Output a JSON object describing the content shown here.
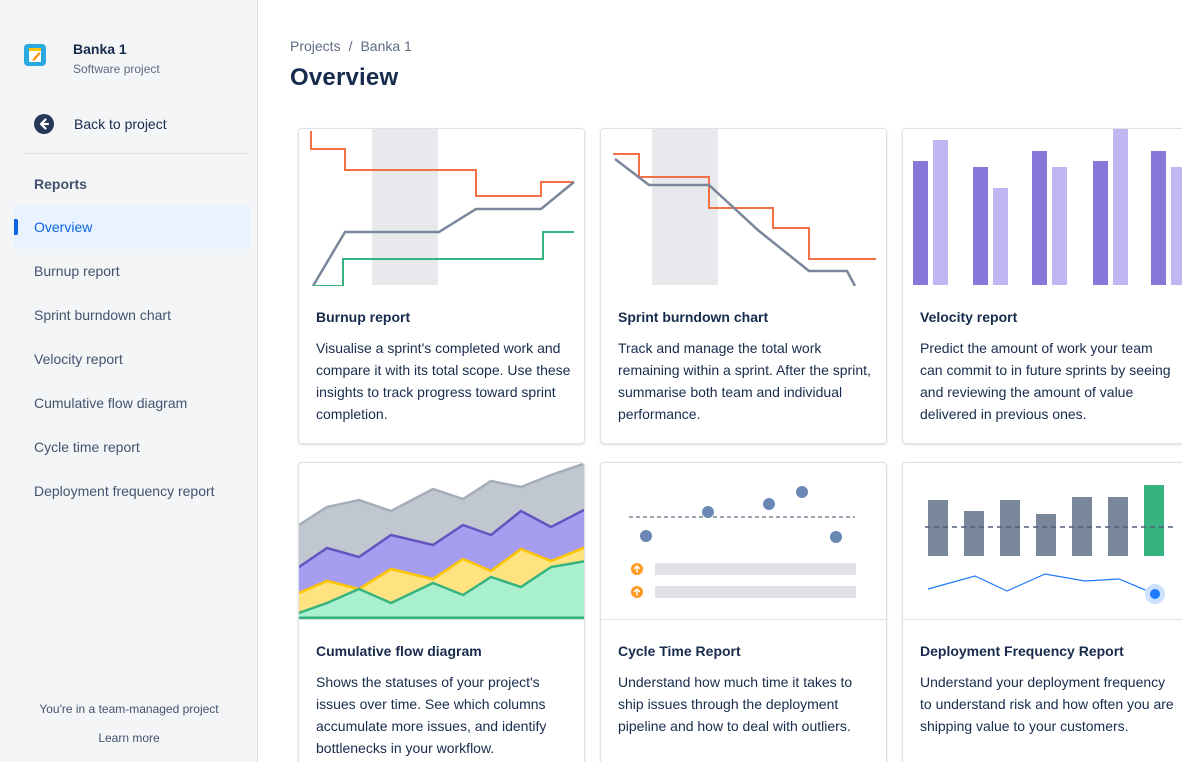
{
  "sidebar": {
    "project_name": "Banka 1",
    "project_type": "Software project",
    "back_label": "Back to project",
    "section_title": "Reports",
    "items": [
      {
        "label": "Overview",
        "active": true
      },
      {
        "label": "Burnup report",
        "active": false
      },
      {
        "label": "Sprint burndown chart",
        "active": false
      },
      {
        "label": "Velocity report",
        "active": false
      },
      {
        "label": "Cumulative flow diagram",
        "active": false
      },
      {
        "label": "Cycle time report",
        "active": false
      },
      {
        "label": "Deployment frequency report",
        "active": false
      }
    ],
    "team_note": "You're in a team-managed project",
    "learn_more": "Learn more"
  },
  "header": {
    "breadcrumb": [
      "Projects",
      "Banka 1"
    ],
    "title": "Overview"
  },
  "cards": [
    {
      "id": "burnup",
      "title": "Burnup report",
      "description": "Visualise a sprint's completed work and compare it with its total scope. Use these insights to track progress toward sprint completion."
    },
    {
      "id": "burndown",
      "title": "Sprint burndown chart",
      "description": "Track and manage the total work remaining within a sprint. After the sprint, summarise both team and individual performance."
    },
    {
      "id": "velocity",
      "title": "Velocity report",
      "description": "Predict the amount of work your team can commit to in future sprints by seeing and reviewing the amount of value delivered in previous ones."
    },
    {
      "id": "cfd",
      "title": "Cumulative flow diagram",
      "description": "Shows the statuses of your project's issues over time. See which columns accumulate more issues, and identify bottlenecks in your workflow."
    },
    {
      "id": "cycle",
      "title": "Cycle Time Report",
      "description": "Understand how much time it takes to ship issues through the deployment pipeline and how to deal with outliers."
    },
    {
      "id": "deploy",
      "title": "Deployment Frequency Report",
      "description": "Understand your deployment frequency to understand risk and how often you are shipping value to your customers."
    }
  ],
  "colors": {
    "active_blue": "#0c66e4",
    "scope_orange": "#f46f45",
    "progress_gray": "#7a869a",
    "done_green": "#36b37e",
    "velocity_dark": "#8777d9",
    "velocity_light": "#c0b6f2",
    "cfd_gray": "#c1c7d0",
    "cfd_purple": "#a79df0",
    "cfd_yellow": "#ffe380",
    "cfd_green": "#a8f0cf",
    "deploy_bar": "#7a869a",
    "deploy_highlight": "#36b37e",
    "deploy_line": "#1d7afc"
  },
  "icons": {
    "project": "project-avatar-icon",
    "back": "arrow-left-circle-icon",
    "cycle_warning": "arrow-up-circle-icon"
  }
}
